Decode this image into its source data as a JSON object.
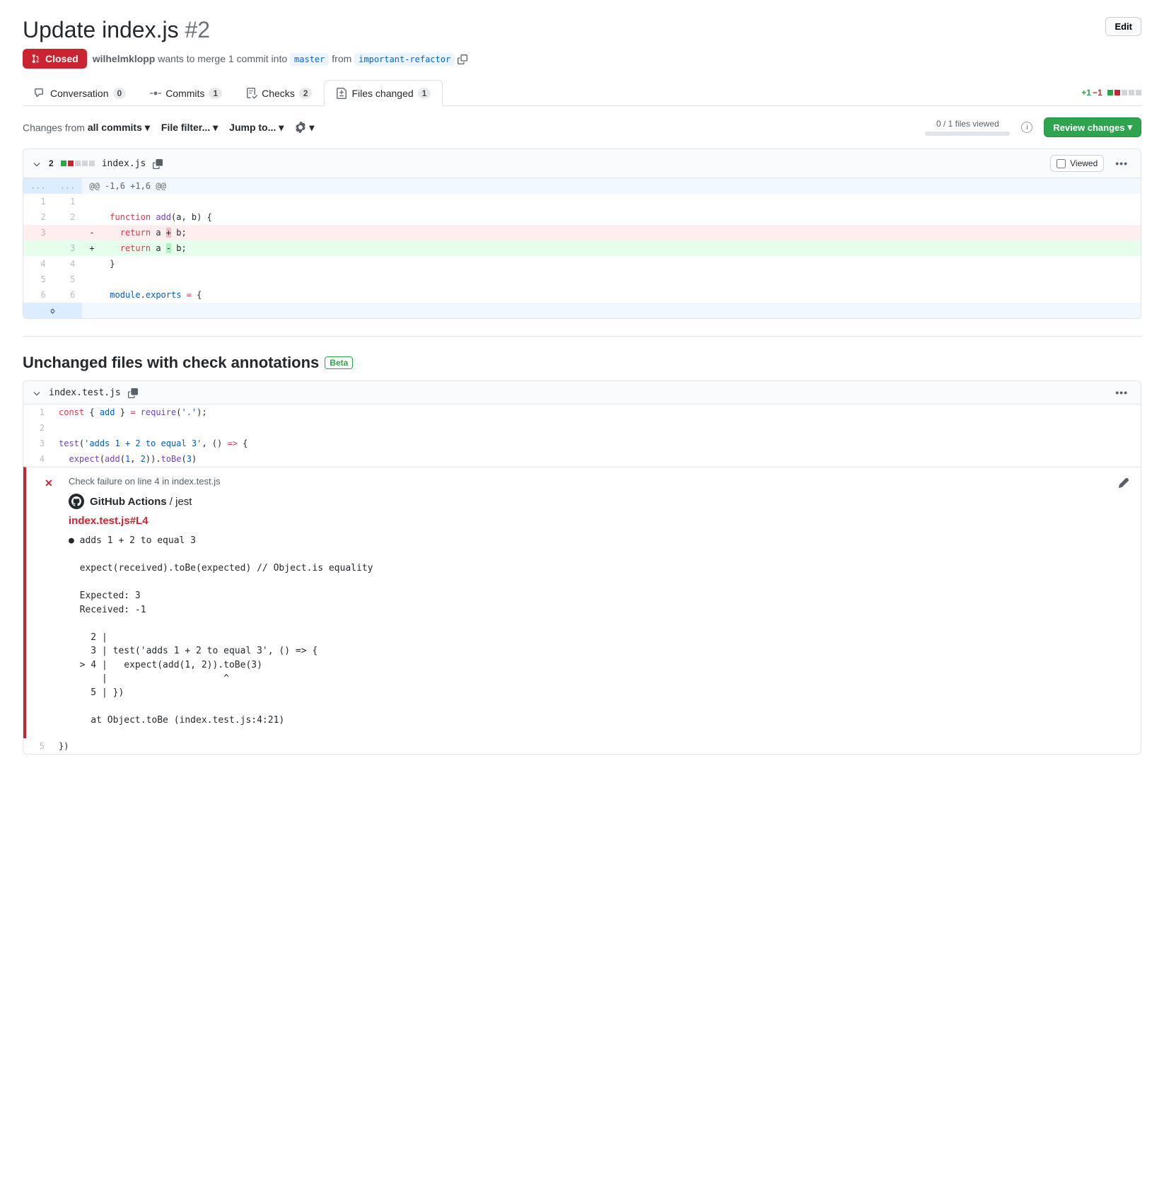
{
  "header": {
    "title": "Update index.js",
    "number": "#2",
    "edit_label": "Edit"
  },
  "meta": {
    "state": "Closed",
    "author": "wilhelmklopp",
    "merge_text_1": "wants to merge 1 commit into",
    "base_branch": "master",
    "merge_text_2": "from",
    "head_branch": "important-refactor"
  },
  "tabs": {
    "conversation": {
      "label": "Conversation",
      "count": "0"
    },
    "commits": {
      "label": "Commits",
      "count": "1"
    },
    "checks": {
      "label": "Checks",
      "count": "2"
    },
    "files": {
      "label": "Files changed",
      "count": "1"
    }
  },
  "diffstat": {
    "add": "+1",
    "del": "−1"
  },
  "toolbar": {
    "changes_from_label": "Changes from",
    "changes_from_value": "all commits",
    "file_filter": "File filter...",
    "jump_to": "Jump to...",
    "viewed_text": "0 / 1 files viewed",
    "review_button": "Review changes"
  },
  "file1": {
    "changes": "2",
    "name": "index.js",
    "viewed_label": "Viewed",
    "hunk": "@@ -1,6 +1,6 @@",
    "rows": [
      {
        "lo": "1",
        "ln": "1",
        "type": "ctx",
        "code": ""
      },
      {
        "lo": "2",
        "ln": "2",
        "type": "ctx",
        "code_html": "  <span class='kw-red'>function</span> <span class='kw-purple'>add</span>(a, b) {"
      },
      {
        "lo": "3",
        "ln": "",
        "type": "del",
        "code_html": "    <span class='kw-red'>return</span> a <span class='del-mark'>+</span> b;"
      },
      {
        "lo": "",
        "ln": "3",
        "type": "add",
        "code_html": "    <span class='kw-red'>return</span> a <span class='add-mark'>-</span> b;"
      },
      {
        "lo": "4",
        "ln": "4",
        "type": "ctx",
        "code": "  }"
      },
      {
        "lo": "5",
        "ln": "5",
        "type": "ctx",
        "code": ""
      },
      {
        "lo": "6",
        "ln": "6",
        "type": "ctx",
        "code_html": "  <span class='kw-blue'>module</span>.<span class='kw-blue'>exports</span> <span class='kw-red'>=</span> {"
      }
    ]
  },
  "section2": {
    "title": "Unchanged files with check annotations",
    "beta": "Beta"
  },
  "file2": {
    "name": "index.test.js",
    "rows": [
      {
        "ln": "1",
        "code_html": "<span class='kw-red'>const</span> { <span class='kw-blue'>add</span> } <span class='kw-red'>=</span> <span class='kw-purple'>require</span>(<span class='kw-blue'>'.'</span>);"
      },
      {
        "ln": "2",
        "code_html": ""
      },
      {
        "ln": "3",
        "code_html": "<span class='kw-purple'>test</span>(<span class='kw-blue'>'adds 1 + 2 to equal 3'</span>, () <span class='kw-red'>=&gt;</span> {"
      },
      {
        "ln": "4",
        "code_html": "  <span class='kw-purple'>expect</span>(<span class='kw-purple'>add</span>(<span class='kw-blue'>1</span>, <span class='kw-blue'>2</span>)).<span class='kw-purple'>toBe</span>(<span class='kw-blue'>3</span>)"
      }
    ],
    "row5": {
      "ln": "5",
      "code": "})"
    }
  },
  "annotation": {
    "failure_line": "Check failure on line 4 in index.test.js",
    "source_app": "GitHub Actions",
    "source_check": "/ jest",
    "link": "index.test.js#L4",
    "body": "● adds 1 + 2 to equal 3\n\n  expect(received).toBe(expected) // Object.is equality\n\n  Expected: 3\n  Received: -1\n\n    2 | \n    3 | test('adds 1 + 2 to equal 3', () => {\n  > 4 |   expect(add(1, 2)).toBe(3)\n      |                     ^\n    5 | })\n\n    at Object.toBe (index.test.js:4:21)"
  }
}
